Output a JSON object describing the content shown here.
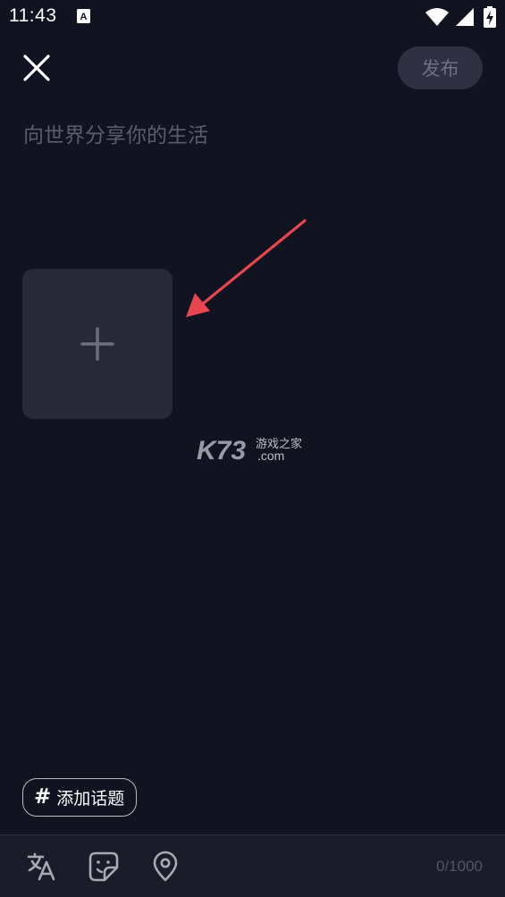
{
  "status_bar": {
    "time": "11:43",
    "notification_icon": "text-a-icon",
    "wifi_icon": "wifi-icon",
    "signal_icon": "signal-icon",
    "battery_icon": "battery-charging-icon"
  },
  "header": {
    "close_icon": "close-icon",
    "publish_label": "发布"
  },
  "composer": {
    "placeholder": "向世界分享你的生活",
    "value": ""
  },
  "media": {
    "add_icon": "plus-icon"
  },
  "watermark": {
    "brand": "K73",
    "sub_text": "游戏之家",
    "domain": ".com"
  },
  "topic": {
    "hash_symbol": "#",
    "label": "添加话题"
  },
  "toolbar": {
    "icons": [
      "translate-icon",
      "sticker-icon",
      "location-pin-icon"
    ],
    "char_count": "0/1000"
  },
  "colors": {
    "background": "#121320",
    "accent_arrow": "#e8464e",
    "tile": "#272838",
    "publish_bg": "#2f3142"
  }
}
